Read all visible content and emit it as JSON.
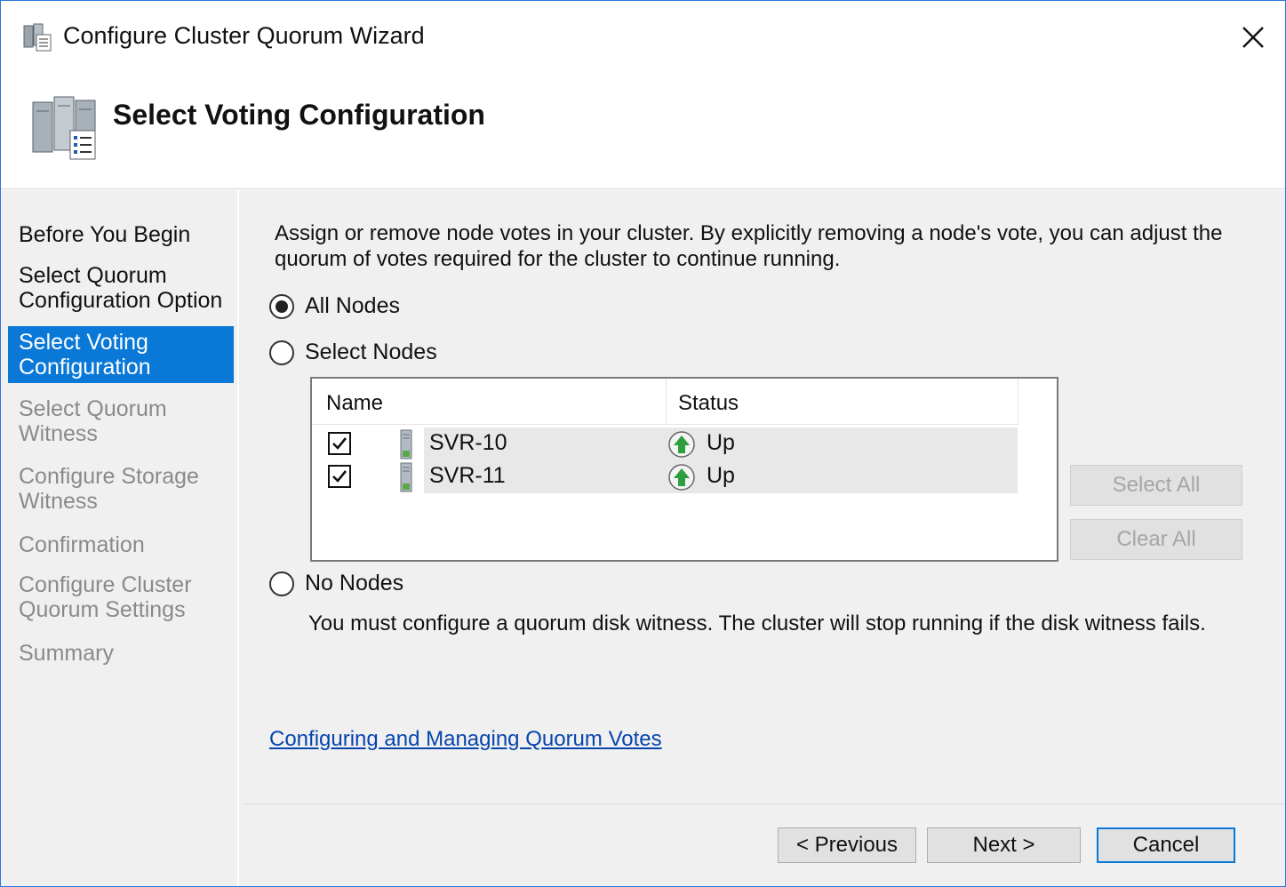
{
  "window": {
    "title": "Configure Cluster Quorum Wizard",
    "icon": "cluster-wizard-icon",
    "close_icon": "close-icon"
  },
  "header": {
    "title": "Select Voting Configuration",
    "icon": "cluster-servers-icon"
  },
  "steps": [
    {
      "label": "Before You Begin",
      "state": "done"
    },
    {
      "label": "Select Quorum Configuration Option",
      "state": "done"
    },
    {
      "label": "Select Voting Configuration",
      "state": "active"
    },
    {
      "label": "Select Quorum Witness",
      "state": "pending"
    },
    {
      "label": "Configure Storage Witness",
      "state": "pending"
    },
    {
      "label": "Confirmation",
      "state": "pending"
    },
    {
      "label": "Configure Cluster Quorum Settings",
      "state": "pending"
    },
    {
      "label": "Summary",
      "state": "pending"
    }
  ],
  "main": {
    "intro": "Assign or remove node votes in your cluster. By explicitly removing a node's vote, you can adjust the quorum of votes required for the cluster to continue running.",
    "options": {
      "all_nodes": {
        "label": "All Nodes",
        "selected": true
      },
      "select_nodes": {
        "label": "Select Nodes",
        "selected": false
      },
      "no_nodes": {
        "label": "No Nodes",
        "selected": false
      }
    },
    "nodes_table": {
      "columns": [
        "Name",
        "Status"
      ],
      "rows": [
        {
          "checked": true,
          "name": "SVR-10",
          "status": "Up",
          "status_icon": "up-arrow-icon"
        },
        {
          "checked": true,
          "name": "SVR-11",
          "status": "Up",
          "status_icon": "up-arrow-icon"
        }
      ]
    },
    "select_all_label": "Select All",
    "clear_all_label": "Clear All",
    "no_nodes_warning": "You must configure a quorum disk witness. The cluster will stop running if the disk witness fails.",
    "help_link": "Configuring and Managing Quorum Votes"
  },
  "footer": {
    "previous_label": "< Previous",
    "next_label": "Next >",
    "cancel_label": "Cancel"
  },
  "colors": {
    "accent": "#0a78d7",
    "link": "#0645ad",
    "status_up": "#2e9e3e"
  }
}
